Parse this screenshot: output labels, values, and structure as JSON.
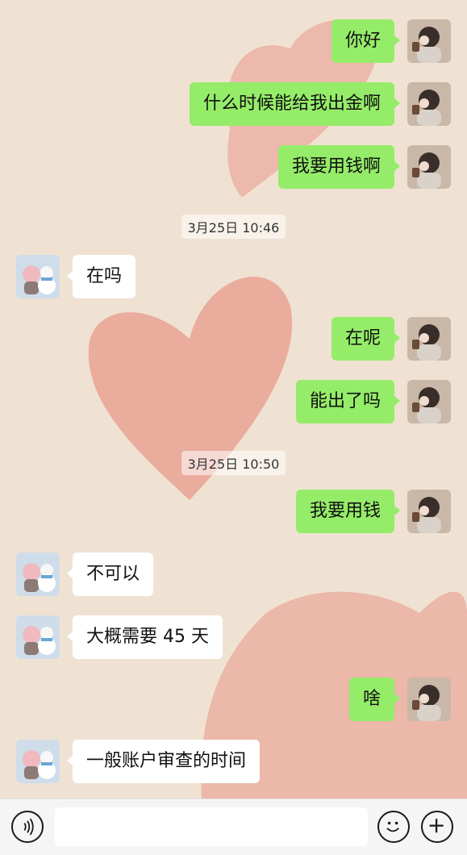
{
  "messages": [
    {
      "type": "out",
      "text": "你好",
      "avatar": "girl-avatar"
    },
    {
      "type": "out",
      "text": "什么时候能给我出金啊",
      "avatar": "girl-avatar"
    },
    {
      "type": "out",
      "text": "我要用钱啊",
      "avatar": "girl-avatar"
    },
    {
      "type": "time",
      "text": "3月25日 10:46"
    },
    {
      "type": "in",
      "text": "在吗",
      "avatar": "pig-snowman-avatar"
    },
    {
      "type": "out",
      "text": "在呢",
      "avatar": "girl-avatar"
    },
    {
      "type": "out",
      "text": "能出了吗",
      "avatar": "girl-avatar"
    },
    {
      "type": "time",
      "text": "3月25日 10:50"
    },
    {
      "type": "out",
      "text": "我要用钱",
      "avatar": "girl-avatar"
    },
    {
      "type": "in",
      "text": "不可以",
      "avatar": "pig-snowman-avatar"
    },
    {
      "type": "in",
      "text": "大概需要 45 天",
      "avatar": "pig-snowman-avatar"
    },
    {
      "type": "out",
      "text": "啥",
      "avatar": "girl-avatar"
    },
    {
      "type": "in",
      "text": "一般账户审查的时间",
      "avatar": "pig-snowman-avatar"
    }
  ],
  "input_bar": {
    "voice_icon": "voice-icon",
    "emoji_icon": "emoji-icon",
    "plus_icon": "plus-icon",
    "input_value": ""
  },
  "colors": {
    "background": "#efe2d3",
    "heart": "#e9a294",
    "outgoing_bubble": "#95ec69",
    "incoming_bubble": "#ffffff"
  }
}
